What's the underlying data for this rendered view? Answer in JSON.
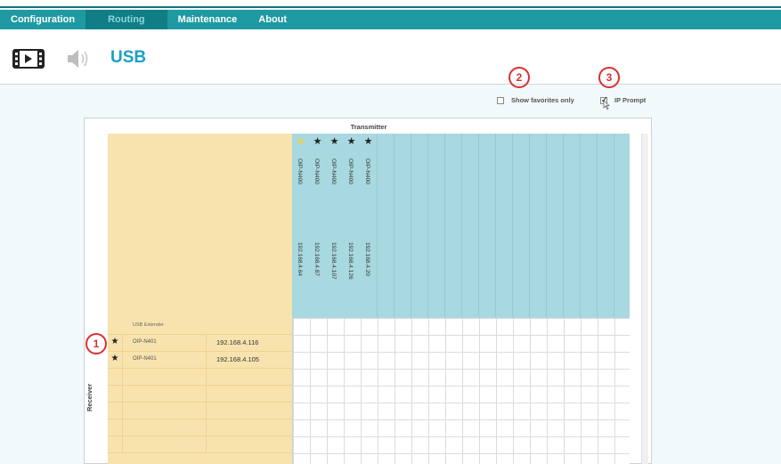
{
  "nav": {
    "tabs": [
      {
        "label": "Configuration"
      },
      {
        "label": "Routing",
        "active": true
      },
      {
        "label": "Maintenance"
      },
      {
        "label": "About"
      }
    ]
  },
  "header": {
    "video_icon": "video-film-icon",
    "audio_icon": "speaker-icon",
    "title": "USB"
  },
  "options": {
    "show_favorites_label": "Show favorites only",
    "show_favorites_checked": false,
    "ip_prompt_label": "IP Prompt",
    "ip_prompt_checked": true
  },
  "callouts": [
    "1",
    "2",
    "3"
  ],
  "matrix": {
    "transmitter_label": "Transmitter",
    "receiver_label": "Receiver",
    "transmitters": [
      {
        "name": "OIP-N400",
        "ip": "192.168.4.64",
        "favorite": true
      },
      {
        "name": "OIP-N400",
        "ip": "192.168.4.87",
        "favorite": false
      },
      {
        "name": "OIP-N400",
        "ip": "192.168.4.107",
        "favorite": false
      },
      {
        "name": "OIP-N400",
        "ip": "192.168.4.126",
        "favorite": false
      },
      {
        "name": "OIP-N400",
        "ip": "192.168.4.20",
        "favorite": false
      }
    ],
    "receiver_group": "USB Extender",
    "receivers": [
      {
        "name": "OIP-N401",
        "ip": "192.168.4.116"
      },
      {
        "name": "OIP-N401",
        "ip": "192.168.4.105"
      }
    ]
  },
  "colors": {
    "nav_bg": "#1f9aa2",
    "nav_active": "#0f7e86",
    "title": "#1aa0c4",
    "receiver_bg": "#f8e3ae",
    "transmitter_bg": "#a8d8e0",
    "callout": "#d9302f"
  }
}
